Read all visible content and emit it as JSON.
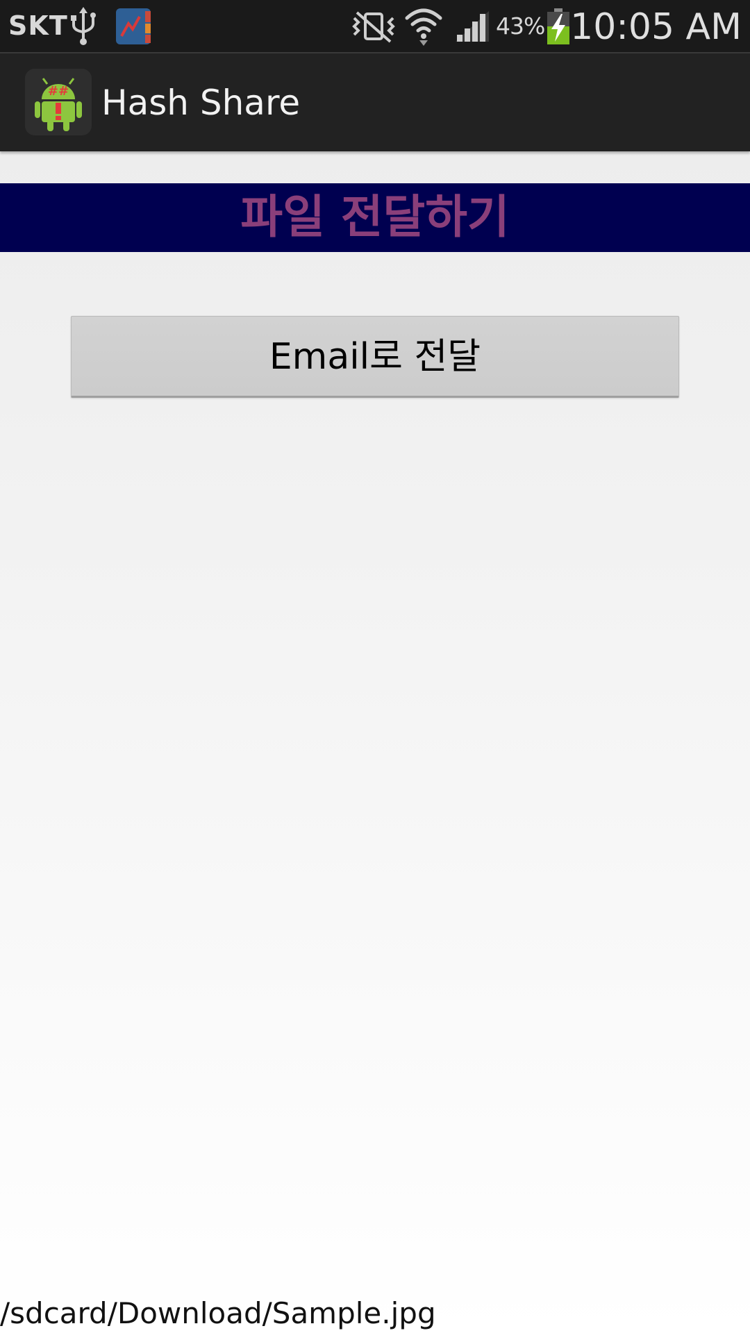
{
  "status_bar": {
    "carrier": "SKT",
    "battery_percent": "43%",
    "time": "10:05 AM",
    "icons": [
      "usb-icon",
      "app-notification-icon",
      "vibrate-mute-icon",
      "wifi-icon",
      "signal-icon",
      "battery-charging-icon"
    ]
  },
  "action_bar": {
    "title": "Hash Share",
    "icon": "android-hash-app-icon"
  },
  "header": {
    "title": "파일 전달하기"
  },
  "email_button": {
    "label": "Email로 전달"
  },
  "file_path": {
    "text": "/sdcard/Download/Sample.jpg"
  },
  "colors": {
    "status_bar_bg": "#1a1a1a",
    "action_bar_bg": "#222222",
    "header_bg": "#000050",
    "header_text": "#8a3f7a",
    "button_bg": "#cccccc"
  }
}
